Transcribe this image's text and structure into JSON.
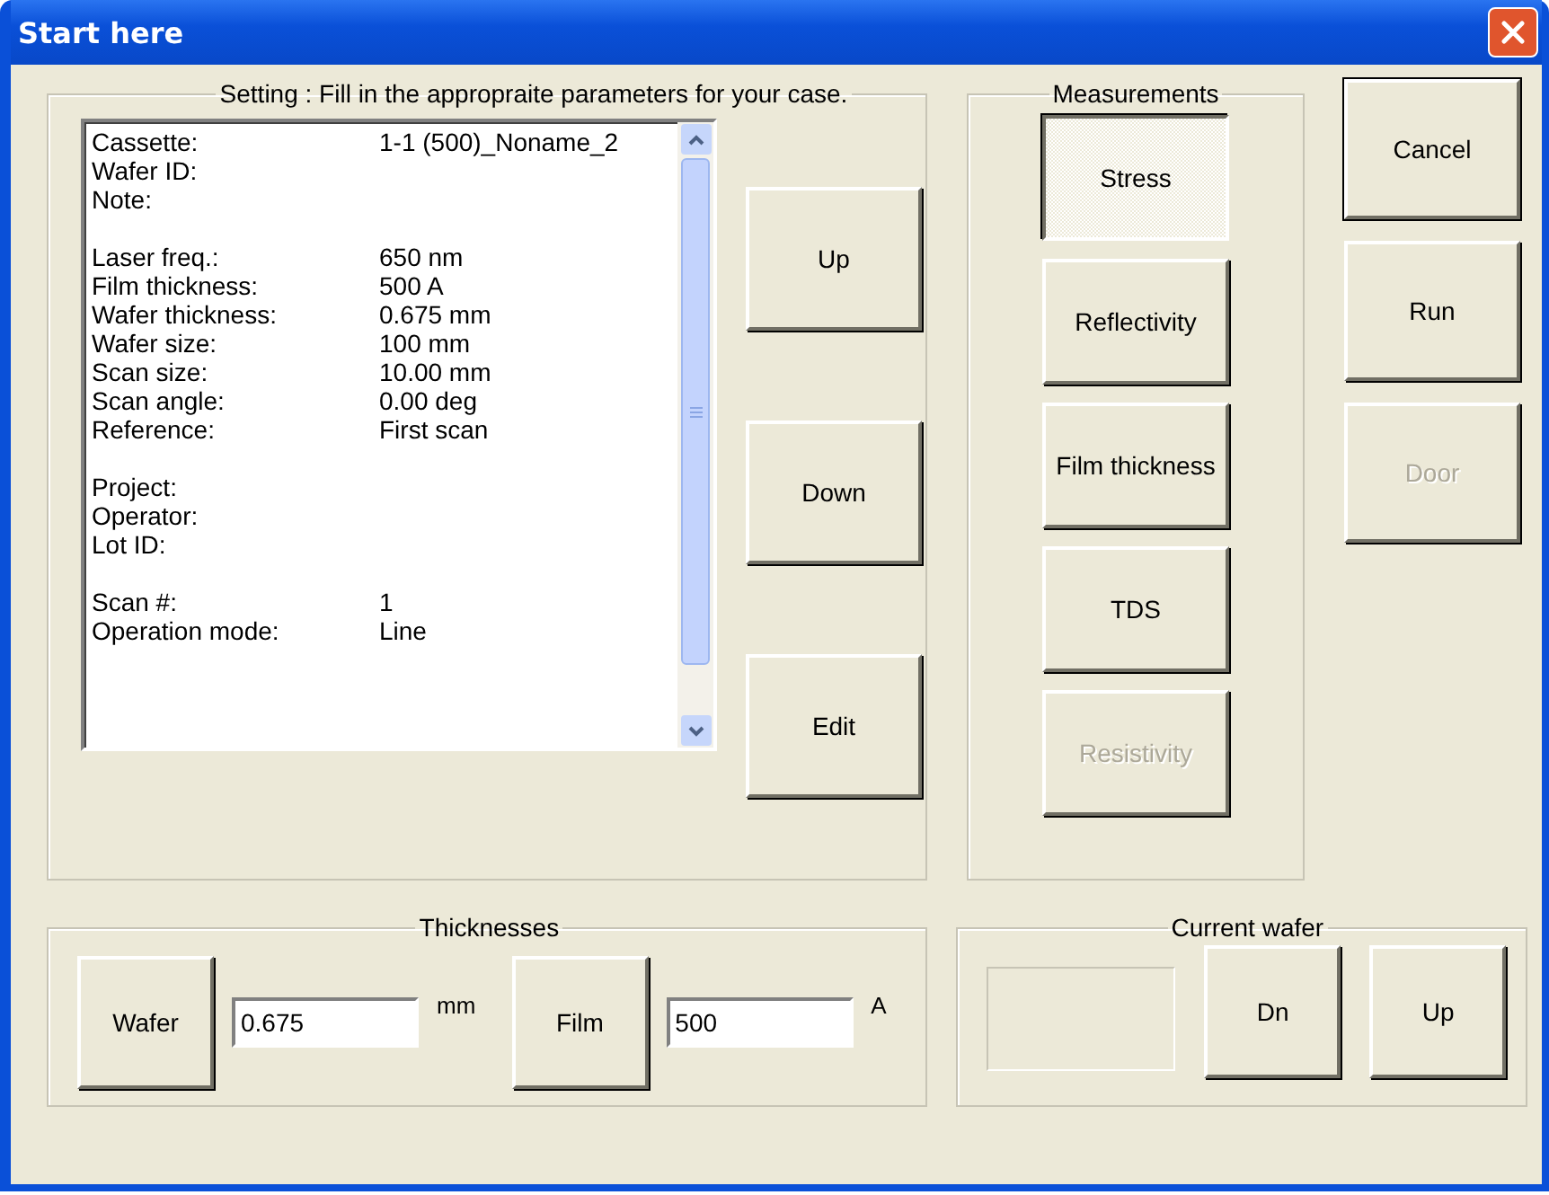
{
  "window": {
    "title": "Start here"
  },
  "setting": {
    "label": "Setting : Fill in the appropraite parameters  for your case.",
    "sections": [
      {
        "rows": [
          {
            "label": "Cassette:",
            "value": "1-1 (500)_Noname_2"
          },
          {
            "label": "Wafer ID:"
          },
          {
            "label": "Note:"
          }
        ]
      },
      {
        "rows": [
          {
            "label": "Laser freq.:",
            "value": "650 nm"
          },
          {
            "label": "Film thickness:",
            "value": "500 A"
          },
          {
            "label": "Wafer thickness:",
            "value": "0.675 mm"
          },
          {
            "label": "Wafer size:",
            "value": "100 mm"
          },
          {
            "label": "Scan size:",
            "value": "10.00 mm"
          },
          {
            "label": "Scan angle:",
            "value": "0.00 deg"
          },
          {
            "label": "Reference:",
            "value": "First scan"
          }
        ]
      },
      {
        "rows": [
          {
            "label": "Project:"
          },
          {
            "label": "Operator:"
          },
          {
            "label": "Lot ID:"
          }
        ]
      },
      {
        "rows": [
          {
            "label": "Scan #:",
            "value": "1"
          },
          {
            "label": "Operation mode:",
            "value": "Line"
          }
        ]
      }
    ],
    "buttons": [
      "Up",
      "Down",
      "Edit"
    ]
  },
  "measurements": {
    "label": "Measurements",
    "buttons": [
      {
        "label": "Stress",
        "selected": true,
        "disabled": false
      },
      {
        "label": "Reflectivity",
        "selected": false,
        "disabled": false
      },
      {
        "label": "Film thickness",
        "selected": false,
        "disabled": false
      },
      {
        "label": "TDS",
        "selected": false,
        "disabled": false
      },
      {
        "label": "Resistivity",
        "selected": false,
        "disabled": true
      }
    ]
  },
  "dialog_buttons": [
    {
      "label": "Cancel",
      "default": true,
      "disabled": false
    },
    {
      "label": "Run",
      "default": false,
      "disabled": false
    },
    {
      "label": "Door",
      "default": false,
      "disabled": true
    }
  ],
  "thicknesses": {
    "label": "Thicknesses",
    "items": [
      {
        "button": "Wafer",
        "value": "0.675",
        "unit": "mm"
      },
      {
        "button": "Film",
        "value": "500",
        "unit": "A"
      }
    ]
  },
  "current_wafer": {
    "label": "Current wafer",
    "field_disabled": true,
    "buttons": [
      "Dn",
      "Up"
    ]
  }
}
